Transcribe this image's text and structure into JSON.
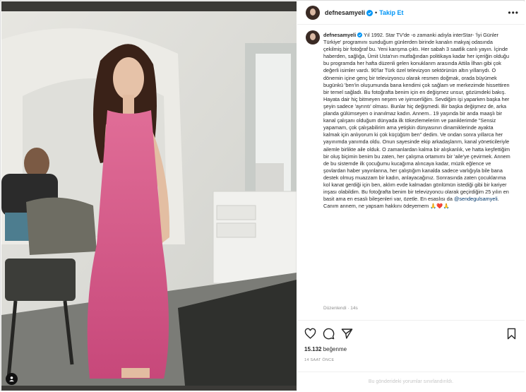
{
  "post": {
    "username": "defnesamyeli",
    "follow_label": "Takip Et",
    "more_label": "•••",
    "caption_prefix": "Yıl 1992. Star TV'de -o zamanki adıyla interStar- 'İyi Günler Türkiye' programını sunduğum günlerden birinde kanalın makyaj odasında çekilmiş bir fotoğraf bu. Yeni karışma çıktı. Her sabah 3 saatlik canlı yayın. İçinde haberden, sağlığa, Ümit Usta'nın mutfağından politikaya kadar her içeriğin olduğu bu programda her hafta düzenli gelen konuklarım arasında Attila İlhan gibi çok değerli isimler vardı. 90'lar Türk özel televizyon sektörünün altın yıllarıydı. O dönemin içine genç bir televizyoncu olarak resmen doğmak, orada büyümek bugünkü 'ben'in oluşumunda bana kendimi çok sağlam ve merkezimde hissettiren bir temel sağladı. Bu fotoğrafta benim için en değişmez unsur, gözümdeki bakış. Hayata dair hiç bitmeyen neşem ve iyimserliğim. Sevdiğim işi yaparken başka her şeyin sadece 'ayrıntı' olması. Bunlar hiç değişmedi. Bir başka değişmez de, arka planda gülümseyen o inanılmaz kadın. Annem.. 19 yaşında bir anda maaşlı bir kanal çalışanı olduğum dünyada ilk tökezlemelerim ve paniklerimde \"Sensiz yapamam, çok çalışabilirim ama yetişkin dünyasının dinamiklerinde ayakta kalmak için anlıyorum ki çok küçüğüm ben\" dedim. Ve ondan sonra yıllarca her yayınımda yanımda oldu. Onun sayesinde ekip arkadaşlarım, kanal yöneticileriyle ailemle birlikte aile olduk. O zamanlardan kalma bir alışkanlık, ve hatta keşfettiğim bir oluş biçimin benim bu zaten, her çalışma ortamımı bir 'aile'ye çevirmek. Annem de bu sistemde ilk çocuğumu kucağıma alıncaya kadar, müzik eğlence ve şovlardan haber yayınlarına, her çalıştığım kanalda sadece varlığıyla bile bana destek olmuş muazzam bir kadın, anlayacağınız. Sonrasında zaten çocuklarıma kol kanat gerdiği için ben, aklım evde kalmadan gönlümün istediği gibi bir kariyer inşası olabildim. Bu fotoğrafta benim bir televizyoncu olarak geçirdiğim 25 yılın en basit ama en esaslı bileşenleri var, özetle. En esaslısı da ",
    "mention": "@sendegulsamyeli",
    "caption_suffix": ". Canım annem, ne yapsam hakkını ödeyemem",
    "caption_emoji": "🙏❤️🙏",
    "edited_label": "Düzenlendi · 14s",
    "likes_count": "15.132",
    "likes_label": "beğenme",
    "timestamp": "14 SAAT ÖNCE",
    "comments_disabled": "Bu gönderideki yorumlar sınırlandırıldı."
  },
  "colors": {
    "accent": "#0095f6",
    "text": "#262626",
    "muted": "#8e8e8e",
    "heart": "#ed4956"
  },
  "icons": [
    "verified-badge-icon",
    "more-options-icon",
    "heart-icon",
    "comment-icon",
    "share-icon",
    "save-bookmark-icon",
    "tagged-user-icon"
  ]
}
